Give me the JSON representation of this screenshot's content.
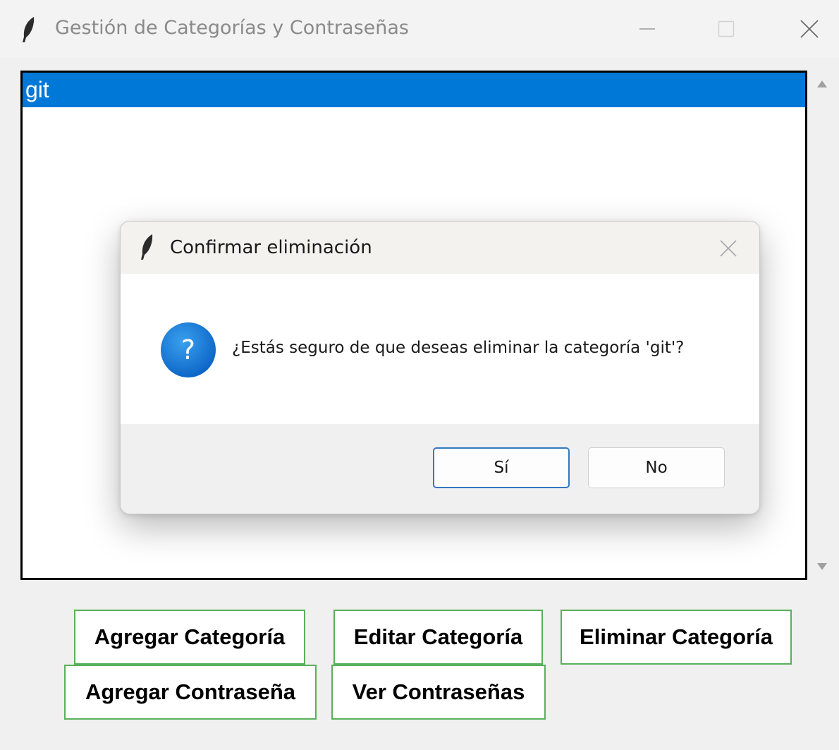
{
  "window": {
    "title": "Gestión de Categorías y Contraseñas",
    "icon": "feather-icon"
  },
  "listbox": {
    "items": [
      {
        "label": "git",
        "selected": true
      }
    ],
    "selection_color": "#0078d7"
  },
  "dialog": {
    "title": "Confirmar eliminación",
    "icon": "question-icon",
    "message": "¿Estás seguro de que deseas eliminar la categoría 'git'?",
    "yes_label": "Sí",
    "no_label": "No"
  },
  "buttons": {
    "add_category": "Agregar Categoría",
    "edit_category": "Editar Categoría",
    "delete_category": "Eliminar Categoría",
    "add_password": "Agregar Contraseña",
    "view_passwords": "Ver Contraseñas",
    "border_color": "#5ab05a"
  }
}
